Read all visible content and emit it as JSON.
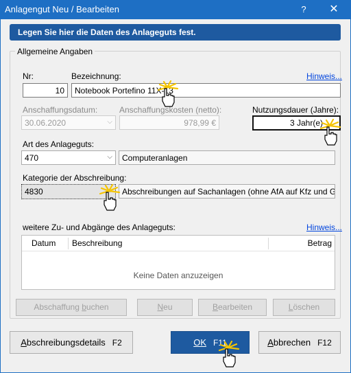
{
  "window": {
    "title": "Anlagengut Neu / Bearbeiten",
    "help_symbol": "?",
    "close_symbol": "✕"
  },
  "banner": {
    "text": "Legen Sie hier die Daten des Anlageguts fest."
  },
  "general": {
    "group_label": "Allgemeine Angaben",
    "nr_label": "Nr:",
    "nr_value": "10",
    "bezeichnung_label": "Bezeichnung:",
    "bezeichnung_value": "Notebook Portefino 11X-13",
    "hinweis_link": "Hinweis...",
    "anschaffungsdatum_label": "Anschaffungsdatum:",
    "anschaffungsdatum_value": "30.06.2020",
    "anschaffungskosten_label": "Anschaffungskosten (netto):",
    "anschaffungskosten_value": "978,99 €",
    "nutzungsdauer_label": "Nutzungsdauer (Jahre):",
    "nutzungsdauer_value": "3 Jahr(e)",
    "art_label": "Art des Anlageguts:",
    "art_code": "470",
    "art_name": "Computeranlagen",
    "kategorie_label": "Kategorie der Abschreibung:",
    "kategorie_code": "4830",
    "kategorie_name": "Abschreibungen auf Sachanlagen (ohne AfA auf Kfz und Gebäude)"
  },
  "movements": {
    "label": "weitere Zu- und Abgänge des Anlageguts:",
    "hinweis_link": "Hinweis...",
    "columns": [
      "Datum",
      "Beschreibung",
      "Betrag"
    ],
    "empty_text": "Keine Daten anzuzeigen",
    "buttons": {
      "abschaffung": [
        "Abschaffung ",
        "b",
        "uchen"
      ],
      "neu": [
        "",
        "N",
        "eu"
      ],
      "bearbeiten": [
        "",
        "B",
        "earbeiten"
      ],
      "loeschen": [
        "",
        "L",
        "öschen"
      ]
    }
  },
  "footer": {
    "details": {
      "label": [
        "",
        "A",
        "bschreibungsdetails"
      ],
      "key": "F2"
    },
    "ok": {
      "label": [
        "",
        "OK",
        ""
      ],
      "key": "F11"
    },
    "cancel": {
      "label": [
        "",
        "A",
        "bbrechen"
      ],
      "key": "F12"
    }
  },
  "colors": {
    "titlebar": "#1e6fc4",
    "banner": "#1e5aa0",
    "link": "#0044dd",
    "cursor_glow": "#f5c400"
  }
}
